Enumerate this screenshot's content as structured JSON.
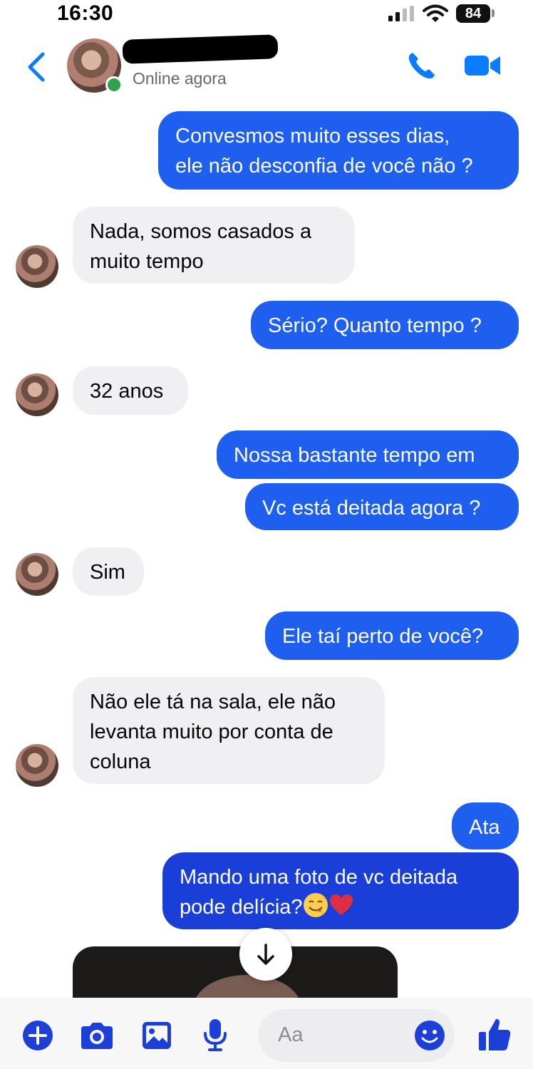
{
  "status_bar": {
    "time": "16:30",
    "battery": "84"
  },
  "header": {
    "status": "Online agora"
  },
  "messages": {
    "m1": {
      "line1": "Convesmos muito esses dias,",
      "line2": "ele não desconfia de você não ?"
    },
    "m2": {
      "line1": "Nada, somos casados a",
      "line2": "muito tempo"
    },
    "m3": "Sério? Quanto tempo ?",
    "m4": "32 anos",
    "m5": "Nossa bastante tempo em",
    "m6": "Vc está deitada agora ?",
    "m7": "Sim",
    "m8": "Ele taí perto de você?",
    "m9": {
      "line1": "Não ele tá na sala, ele não",
      "line2": "levanta muito por conta de",
      "line3": "coluna"
    },
    "m10": "Ata",
    "m11": {
      "line1": "Mando uma foto de vc deitada",
      "line2": "pode delícia?"
    }
  },
  "composer": {
    "placeholder": "Aa"
  },
  "colors": {
    "sent_bubble": "#1f5ff0",
    "received_bubble": "#f0f0f2",
    "accent": "#0a7cff",
    "composer_icons": "#1c3fd8",
    "online": "#31a24c"
  },
  "icons": [
    "back-icon",
    "phone-icon",
    "video-call-icon",
    "scroll-down-icon",
    "plus-icon",
    "camera-icon",
    "gallery-icon",
    "microphone-icon",
    "emoji-icon",
    "like-icon"
  ]
}
